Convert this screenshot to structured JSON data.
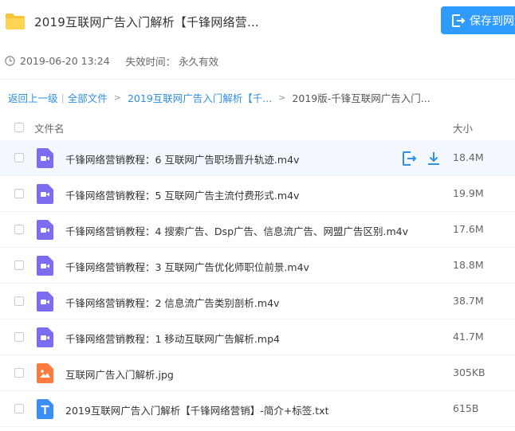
{
  "header": {
    "title": "2019互联网广告入门解析【千锋网络营...",
    "save_label": "保存到网盘"
  },
  "meta": {
    "share_time": "2019-06-20 13:24",
    "expire_label": "失效时间：",
    "expire_value": "永久有效"
  },
  "breadcrumb": {
    "back": "返回上一级",
    "separator": "|",
    "all_files": "全部文件",
    "level1": "2019互联网广告入门解析【千...",
    "gt": ">",
    "current": "2019版-千锋互联网广告入门..."
  },
  "table": {
    "col_name": "文件名",
    "col_size": "大小"
  },
  "files": [
    {
      "name": "千锋网络营销教程：6 互联网广告职场晋升轨迹.m4v",
      "size": "18.4M",
      "type": "video-icon"
    },
    {
      "name": "千锋网络营销教程：5 互联网广告主流付费形式.m4v",
      "size": "19.9M",
      "type": "video-icon"
    },
    {
      "name": "千锋网络营销教程：4 搜索广告、Dsp广告、信息流广告、网盟广告区别.m4v",
      "size": "17.6M",
      "type": "video-icon"
    },
    {
      "name": "千锋网络营销教程：3 互联网广告优化师职位前景.m4v",
      "size": "18.8M",
      "type": "video-icon"
    },
    {
      "name": "千锋网络营销教程：2 信息流广告类别剖析.m4v",
      "size": "38.7M",
      "type": "video-icon"
    },
    {
      "name": "千锋网络营销教程：1 移动互联网广告解析.mp4",
      "size": "41.7M",
      "type": "video-icon"
    },
    {
      "name": "互联网广告入门解析.jpg",
      "size": "305KB",
      "type": "image-icon"
    },
    {
      "name": "2019互联网广告入门解析【千锋网络营销】-简介+标签.txt",
      "size": "615B",
      "type": "text-icon"
    }
  ],
  "icons": {
    "folder": "folder-icon",
    "clock": "clock-icon",
    "save": "save-to-disk-icon",
    "row_actions": [
      "save-to-disk-icon",
      "download-icon"
    ]
  },
  "colors": {
    "accent": "#2f9bff",
    "link": "#2f8fe6",
    "video": "#7b6cf0",
    "image": "#f97b3d",
    "text": "#3b8ef5",
    "folder": "#f8c436"
  }
}
